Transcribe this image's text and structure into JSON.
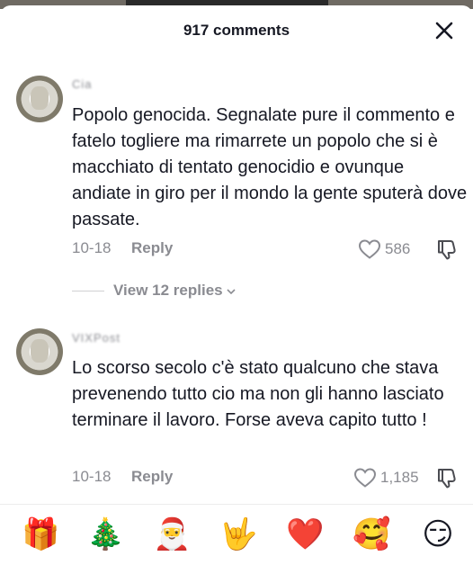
{
  "header": {
    "title": "917 comments",
    "close_icon": "close-icon"
  },
  "comments": [
    {
      "username": "Cia",
      "text": "Popolo genocida. Segnalate pure il commento e fatelo togliere ma rimarrete un popolo che si è macchiato di tentato genocidio e ovunque andiate in giro per il mondo la gente sputerà dove passate.",
      "date": "10-18",
      "reply_label": "Reply",
      "likes": "586",
      "view_replies": "View 12 replies"
    },
    {
      "username": "VIXPost",
      "text": "Lo scorso secolo c'è stato qualcuno che stava prevenendo tutto cio ma non gli hanno lasciato terminare il lavoro. Forse aveva capito tutto !",
      "date": "10-18",
      "reply_label": "Reply",
      "likes": "1,185"
    }
  ],
  "emoji_bar": [
    "🎁",
    "🎄",
    "🎅",
    "🤟",
    "❤️",
    "🥰",
    "😏"
  ],
  "colors": {
    "text": "#161823",
    "muted": "#8a8b91",
    "divider": "#d0d1d3"
  }
}
